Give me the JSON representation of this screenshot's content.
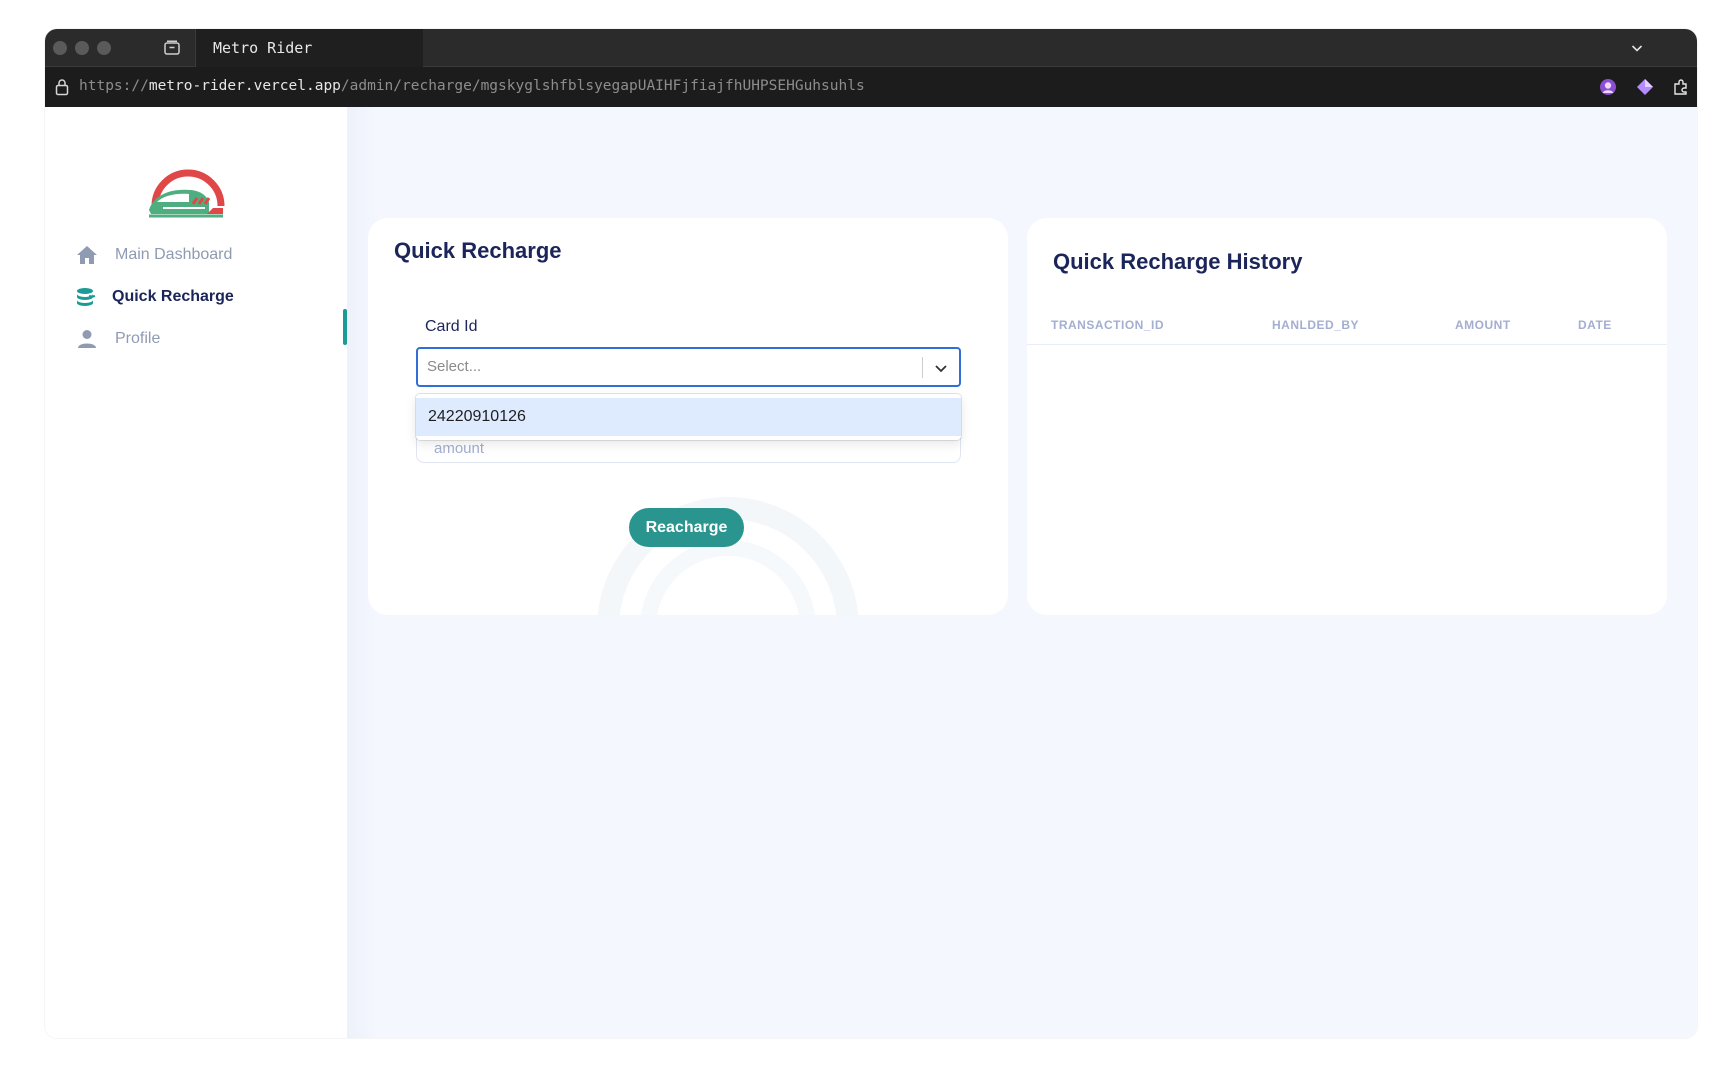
{
  "browser": {
    "tab_title": "Metro Rider",
    "url_scheme": "https://",
    "url_host": "metro-rider.vercel.app",
    "url_path": "/admin/recharge/mgskyglshfblsyegapUAIHFjfiajfhUHPSEHGuhsuhls"
  },
  "sidebar": {
    "logo": "metro-train-logo",
    "items": [
      {
        "label": "Main Dashboard",
        "icon": "home-icon",
        "active": false
      },
      {
        "label": "Quick Recharge",
        "icon": "coins-icon",
        "active": true
      },
      {
        "label": "Profile",
        "icon": "person-icon",
        "active": false
      }
    ]
  },
  "recharge": {
    "title": "Quick Recharge",
    "card_label": "Card Id",
    "select_placeholder": "Select...",
    "options": [
      "24220910126"
    ],
    "amount_placeholder": "amount",
    "button_label": "Reacharge"
  },
  "history": {
    "title": "Quick Recharge History",
    "columns": [
      "TRANSACTION_ID",
      "HANLDED_BY",
      "AMOUNT",
      "DATE"
    ],
    "rows": []
  },
  "colors": {
    "accent": "#2a958f",
    "heading": "#1b2559",
    "muted": "#a3aed0",
    "focus": "#2f6fd6",
    "option_highlight": "#deebff"
  }
}
